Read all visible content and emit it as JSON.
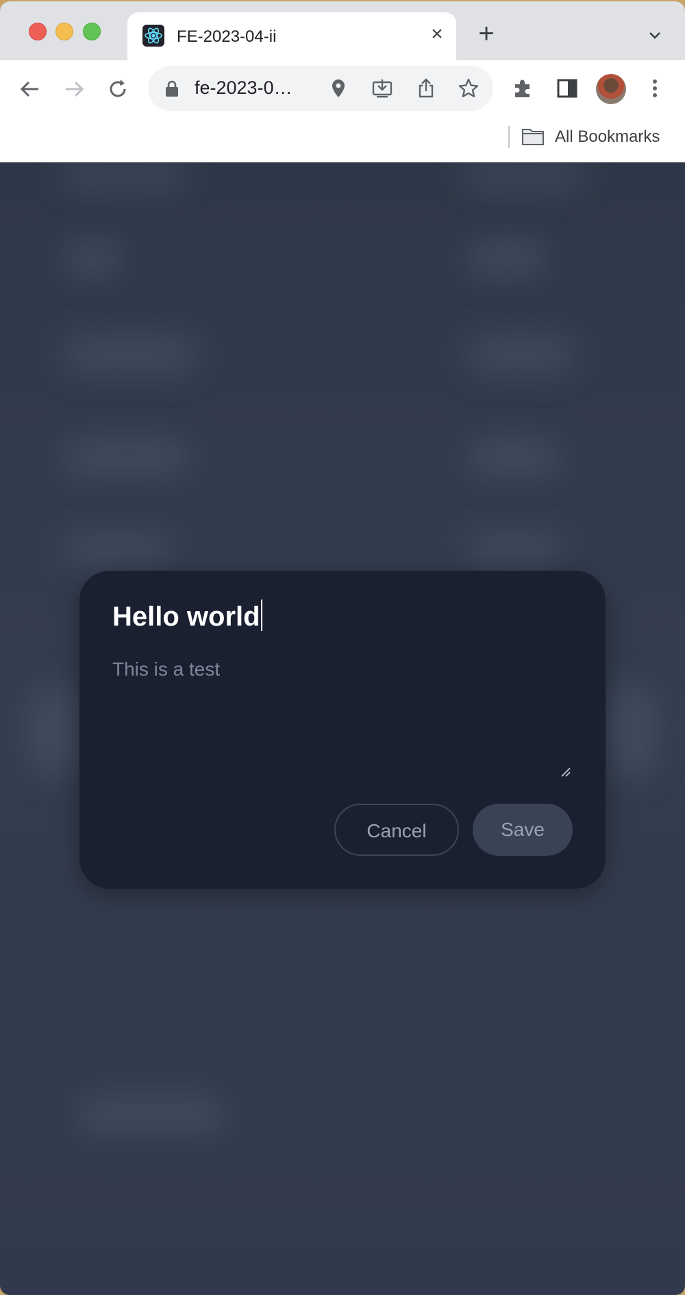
{
  "browser": {
    "tab_title": "FE-2023-04-ii",
    "url": "fe-2023-0…",
    "bookmarks_label": "All Bookmarks"
  },
  "icons": {
    "favicon": "react-logo-icon",
    "close": "close-icon",
    "new_tab": "plus-icon",
    "tab_menu": "chevron-down-icon",
    "back": "back-arrow-icon",
    "forward": "forward-arrow-icon",
    "reload": "reload-icon",
    "lock": "lock-icon",
    "location": "location-pin-icon",
    "install": "install-app-icon",
    "share": "share-icon",
    "bookmark": "star-icon",
    "extensions": "puzzle-icon",
    "side_panel": "side-panel-icon",
    "menu": "kebab-menu-icon",
    "folder": "folder-icon",
    "resize": "resize-handle-icon"
  },
  "modal": {
    "title_value": "Hello world",
    "body_value": "This is a test",
    "cancel_label": "Cancel",
    "save_label": "Save"
  },
  "colors": {
    "page_background": "#2f3848",
    "modal_background": "#1b2031",
    "button_text": "#9aa2b2"
  }
}
